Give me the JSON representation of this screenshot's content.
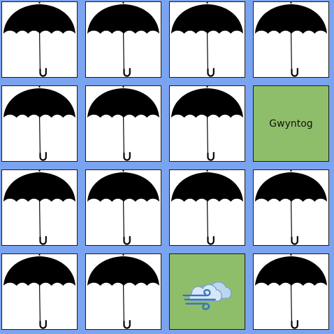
{
  "board": {
    "rows": 4,
    "cols": 4,
    "cards": [
      {
        "state": "face-down",
        "icon": "umbrella-icon"
      },
      {
        "state": "face-down",
        "icon": "umbrella-icon"
      },
      {
        "state": "face-down",
        "icon": "umbrella-icon"
      },
      {
        "state": "face-down",
        "icon": "umbrella-icon"
      },
      {
        "state": "face-down",
        "icon": "umbrella-icon"
      },
      {
        "state": "face-down",
        "icon": "umbrella-icon"
      },
      {
        "state": "face-down",
        "icon": "umbrella-icon"
      },
      {
        "state": "revealed",
        "label": "Gwyntog"
      },
      {
        "state": "face-down",
        "icon": "umbrella-icon"
      },
      {
        "state": "face-down",
        "icon": "umbrella-icon"
      },
      {
        "state": "face-down",
        "icon": "umbrella-icon"
      },
      {
        "state": "face-down",
        "icon": "umbrella-icon"
      },
      {
        "state": "face-down",
        "icon": "umbrella-icon"
      },
      {
        "state": "face-down",
        "icon": "umbrella-icon"
      },
      {
        "state": "revealed",
        "icon": "windy-cloud-icon"
      },
      {
        "state": "face-down",
        "icon": "umbrella-icon"
      }
    ]
  },
  "colors": {
    "background": "#7aa3f0",
    "card_back": "#ffffff",
    "card_revealed": "#8fbe6a",
    "umbrella": "#000000"
  }
}
